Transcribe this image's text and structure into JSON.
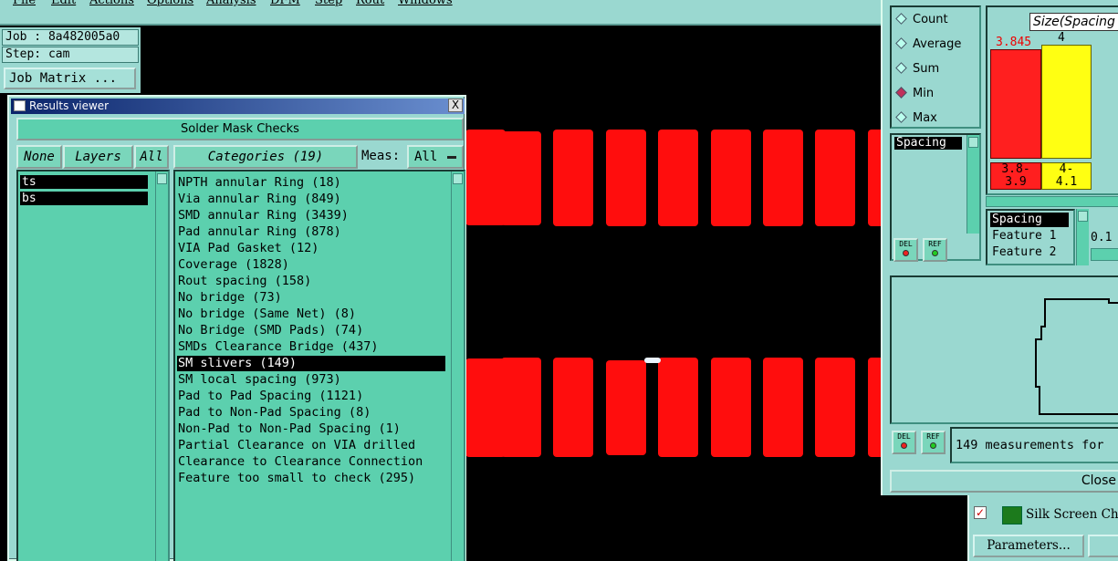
{
  "menubar": {
    "items": [
      "File",
      "Edit",
      "Actions",
      "Options",
      "Analysis",
      "DFM",
      "Step",
      "Rout",
      "Windows"
    ]
  },
  "job": {
    "job_label": "Job : 8a482005a0",
    "step_label": "Step: cam",
    "matrix_button": "Job Matrix ..."
  },
  "viewer": {
    "title": "Results viewer",
    "close_glyph": "X",
    "header": "Solder Mask Checks",
    "none_button": "None",
    "layers_button": "Layers",
    "all_button": "All",
    "layers": [
      "ts",
      "bs"
    ],
    "categories_button": "Categories (19)",
    "meas_label": "Meas:",
    "meas_value": "All",
    "categories": [
      "NPTH annular Ring (18)",
      "Via annular Ring (849)",
      "SMD annular Ring (3439)",
      "Pad annular Ring (878)",
      "VIA Pad Gasket (12)",
      "Coverage (1828)",
      "Rout spacing (158)",
      "No bridge (73)",
      "No bridge (Same Net) (8)",
      "No Bridge (SMD Pads) (74)",
      "SMDs Clearance Bridge (437)",
      "SM slivers (149)",
      "SM local spacing (973)",
      "Pad to Pad Spacing (1121)",
      "Pad to Non-Pad Spacing (8)",
      "Non-Pad to Non-Pad Spacing (1)",
      "Partial Clearance on VIA drilled",
      "Clearance to Clearance Connection",
      "Feature too small to check (295)"
    ],
    "selected_category": "SM slivers (149)"
  },
  "stats": {
    "modes": [
      "Count",
      "Average",
      "Sum",
      "Min",
      "Max"
    ],
    "selected_mode": "Min",
    "measure_selected": "Spacing",
    "del_label": "DEL",
    "ref_label": "REF",
    "histogram_title": "Size(Spacing",
    "bar1_value": "3.845",
    "bar2_value": "4",
    "bin1_label": "3.8-\n3.9",
    "bin2_label": "4-\n4.1",
    "detail_rows": [
      "Spacing",
      "Feature 1",
      "Feature 2"
    ],
    "step_value": "0.1",
    "measure_info": "149 measurements for",
    "close_button": "Close"
  },
  "silk": {
    "label": "Silk Screen Che",
    "checked_glyph": "✓",
    "parameters_button": "Parameters..."
  },
  "colors": {
    "panel": "#9ad8d0",
    "list_bg": "#5cd0ae",
    "pad_red": "#ff0d0d",
    "bar_yellow": "#ffff12"
  }
}
